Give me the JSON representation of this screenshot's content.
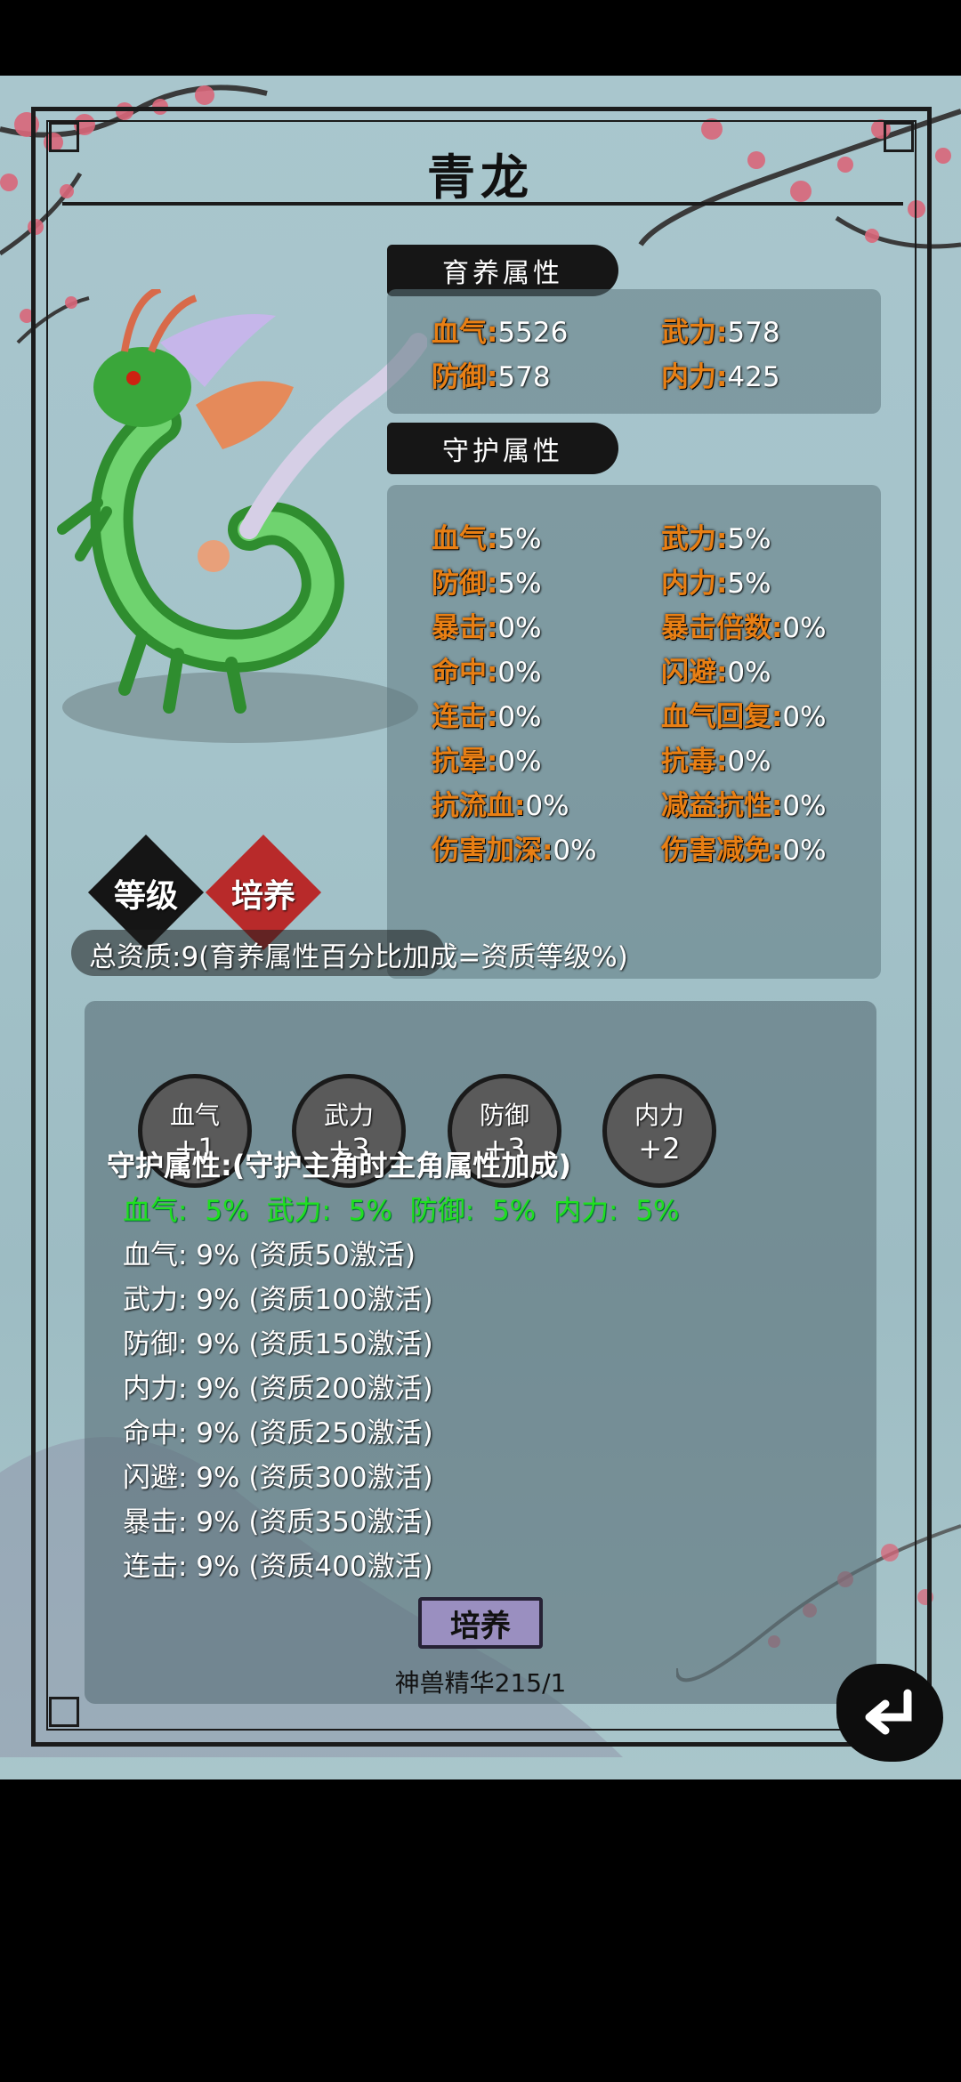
{
  "title": "青龙",
  "nurture_section": {
    "label": "育养属性",
    "stats": [
      {
        "name": "血气:",
        "value": "5526"
      },
      {
        "name": "武力:",
        "value": "578"
      },
      {
        "name": "防御:",
        "value": "578"
      },
      {
        "name": "内力:",
        "value": "425"
      }
    ]
  },
  "guard_section": {
    "label": "守护属性",
    "stats": [
      {
        "name": "血气:",
        "value": "5%"
      },
      {
        "name": "武力:",
        "value": "5%"
      },
      {
        "name": "防御:",
        "value": "5%"
      },
      {
        "name": "内力:",
        "value": "5%"
      },
      {
        "name": "暴击:",
        "value": "0%"
      },
      {
        "name": "暴击倍数:",
        "value": "0%"
      },
      {
        "name": "命中:",
        "value": "0%"
      },
      {
        "name": "闪避:",
        "value": "0%"
      },
      {
        "name": "连击:",
        "value": "0%"
      },
      {
        "name": "血气回复:",
        "value": "0%"
      },
      {
        "name": "抗晕:",
        "value": "0%"
      },
      {
        "name": "抗毒:",
        "value": "0%"
      },
      {
        "name": "抗流血:",
        "value": "0%"
      },
      {
        "name": "减益抗性:",
        "value": "0%"
      },
      {
        "name": "伤害加深:",
        "value": "0%"
      },
      {
        "name": "伤害减免:",
        "value": "0%"
      }
    ]
  },
  "tabs": {
    "level": "等级",
    "cultivate": "培养"
  },
  "aptitude_note": "总资质:9(育养属性百分比加成=资质等级%)",
  "bonus_circles": [
    {
      "name": "血气",
      "plus": "+1"
    },
    {
      "name": "武力",
      "plus": "+3"
    },
    {
      "name": "防御",
      "plus": "+3"
    },
    {
      "name": "内力",
      "plus": "+2"
    }
  ],
  "guard_info": {
    "title": "守护属性:(守护主角时主角属性加成)",
    "active": "血气: 5%  武力: 5%  防御: 5%  内力: 5%",
    "rows": [
      "血气: 9% (资质50激活)",
      "武力: 9% (资质100激活)",
      "防御: 9% (资质150激活)",
      "内力: 9% (资质200激活)",
      "命中: 9% (资质250激活)",
      "闪避: 9% (资质300激活)",
      "暴击: 9% (资质350激活)",
      "连击: 9% (资质400激活)"
    ]
  },
  "cultivate_button": "培养",
  "essence": "神兽精华215/1",
  "colors": {
    "stat_key": "#e87f14",
    "active_green": "#1fe01f",
    "button": "#9a8fc0"
  },
  "icons": {
    "back": "back-arrow-icon",
    "dragon": "dragon-illustration"
  }
}
